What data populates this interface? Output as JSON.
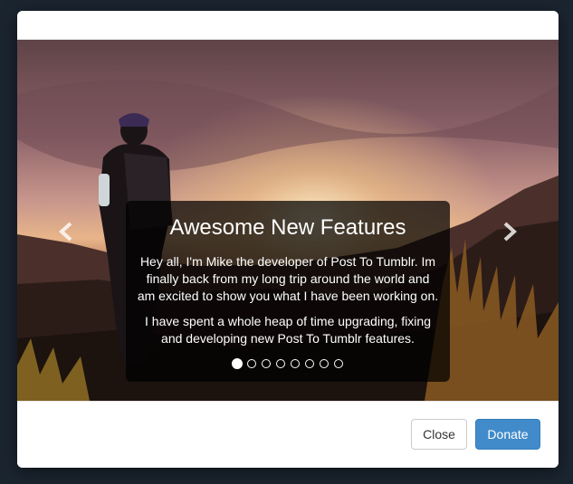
{
  "carousel": {
    "slide": {
      "title": "Awesome New Features",
      "paragraph_1": "Hey all, I'm Mike the developer of Post To Tumblr. Im finally back from my long trip around the world and am excited to show you what I have been working on.",
      "paragraph_2": "I have spent a whole heap of time upgrading, fixing and developing new Post To Tumblr features."
    },
    "indicators_total": 8,
    "active_indicator": 1,
    "prev_icon": "chevron-left-icon",
    "next_icon": "chevron-right-icon"
  },
  "footer": {
    "close_label": "Close",
    "donate_label": "Donate"
  },
  "colors": {
    "backdrop": "#1b2530",
    "donate_button": "#428bca",
    "caption_bg": "rgba(0,0,0,0.72)"
  }
}
